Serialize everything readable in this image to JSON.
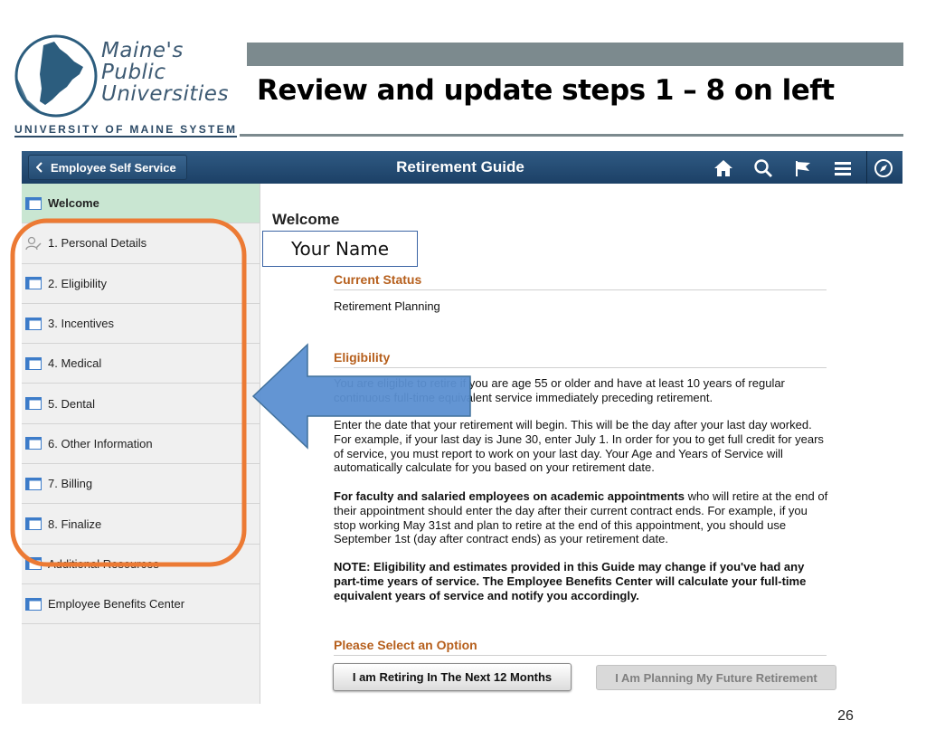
{
  "logo": {
    "line1": "Maine's",
    "line2": "Public",
    "line3": "Universities",
    "subtitle": "UNIVERSITY OF MAINE SYSTEM"
  },
  "slide": {
    "title": "Review and update steps 1 – 8 on left",
    "page_number": "26",
    "name_callout": "Your Name"
  },
  "app": {
    "back_label": "Employee Self Service",
    "title": "Retirement Guide",
    "toolbar_icons": [
      "home-icon",
      "search-icon",
      "flag-icon",
      "menu-icon",
      "navbar-icon"
    ]
  },
  "sidebar": {
    "items": [
      {
        "label": "Welcome",
        "icon": "page-icon",
        "active": true
      },
      {
        "label": "1. Personal Details",
        "icon": "person-edit-icon",
        "active": false
      },
      {
        "label": "2. Eligibility",
        "icon": "page-icon",
        "active": false
      },
      {
        "label": "3. Incentives",
        "icon": "page-icon",
        "active": false
      },
      {
        "label": "4. Medical",
        "icon": "page-icon",
        "active": false
      },
      {
        "label": "5. Dental",
        "icon": "page-icon",
        "active": false
      },
      {
        "label": "6. Other Information",
        "icon": "page-icon",
        "active": false
      },
      {
        "label": "7. Billing",
        "icon": "page-icon",
        "active": false
      },
      {
        "label": "8. Finalize",
        "icon": "page-icon",
        "active": false
      },
      {
        "label": "Additional Resources",
        "icon": "page-icon",
        "active": false
      },
      {
        "label": "Employee Benefits Center",
        "icon": "page-icon",
        "active": false
      }
    ]
  },
  "content": {
    "heading": "Welcome",
    "current_status": {
      "heading": "Current Status",
      "value": "Retirement Planning"
    },
    "eligibility": {
      "heading": "Eligibility",
      "p1": "You are eligible to retire if you are age 55 or older and have at least 10 years of regular continuous full-time equivalent service immediately preceding retirement.",
      "p2": "Enter the date that your retirement will begin. This will be the day after your last day worked. For example, if your last day is June 30, enter July 1. In order for you to get full credit for years of service, you must report to work on your last day. Your Age and Years of Service will automatically calculate for you based on your retirement date.",
      "p3_bold": "For faculty and salaried employees on academic appointments",
      "p3_rest": " who will retire at the end of their appointment should enter the day after their current contract ends. For example, if you stop working May 31st and plan to retire at the end of this appointment, you should use September 1st (day after contract ends) as your retirement date.",
      "note": "NOTE: Eligibility and estimates provided in this Guide may change if you've had any part-time years of service. The Employee Benefits Center will calculate your full-time equivalent years of service and notify you accordingly."
    },
    "options": {
      "heading": "Please Select an Option",
      "button1": "I am Retiring In The Next 12 Months",
      "button2": "I Am Planning My Future Retirement"
    }
  },
  "colors": {
    "topbar": "#1c4066",
    "active_nav": "#c9e6d2",
    "section_heading": "#b65f1c",
    "callout_outline": "#ec7a34",
    "arrow_fill": "#5b8fd1",
    "logo": "#3d5a73"
  }
}
